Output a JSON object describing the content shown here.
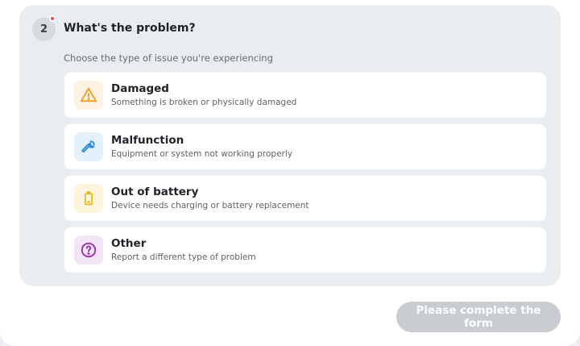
{
  "step": {
    "number": "2",
    "title": "What's the problem?",
    "subtitle": "Choose the type of issue you're experiencing"
  },
  "options": [
    {
      "label": "Damaged",
      "description": "Something is broken or physically damaged",
      "icon": "warning-icon",
      "icon_color": "#f29d1b",
      "icon_bg": "#fdf2e3"
    },
    {
      "label": "Malfunction",
      "description": "Equipment or system not working properly",
      "icon": "wrench-icon",
      "icon_color": "#2f8fd8",
      "icon_bg": "#e4f1fb"
    },
    {
      "label": "Out of battery",
      "description": "Device needs charging or battery replacement",
      "icon": "battery-icon",
      "icon_color": "#e8b617",
      "icon_bg": "#fdf6dc"
    },
    {
      "label": "Other",
      "description": "Report a different type of problem",
      "icon": "question-icon",
      "icon_color": "#9b2bb3",
      "icon_bg": "#f3e4f6"
    }
  ],
  "submit_label": "Please complete the form",
  "colors": {
    "accent_disabled": "#c9ccd0",
    "step_badge_dot": "#e94d4d"
  }
}
